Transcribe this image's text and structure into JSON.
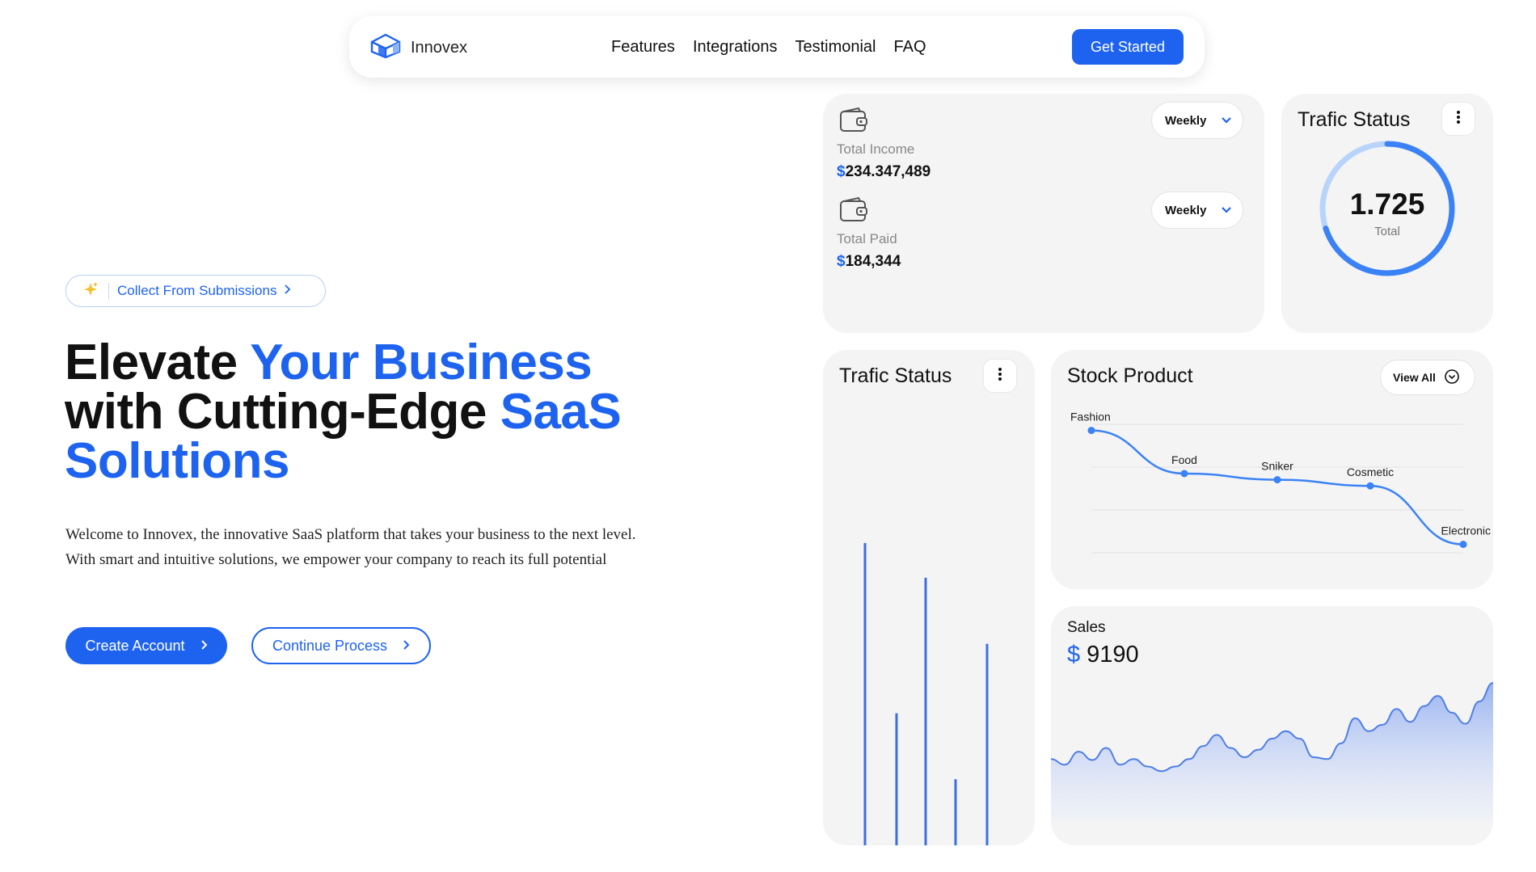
{
  "nav": {
    "brand": "Innovex",
    "links": [
      "Features",
      "Integrations",
      "Testimonial",
      "FAQ"
    ],
    "cta": "Get Started"
  },
  "hero": {
    "pill": "Collect From Submissions",
    "title_parts": [
      "Elevate ",
      "Your Business",
      " with Cutting-Edge ",
      "SaaS Solutions"
    ],
    "description": "Welcome to Innovex, the innovative SaaS platform that takes your business to the next level. With smart and intuitive solutions, we empower your company to reach its full potential",
    "create_btn": "Create Account",
    "continue_btn": "Continue Process"
  },
  "income_card": {
    "income_label": "Total Income",
    "income_currency": "$",
    "income_value": "234.347,489",
    "income_period": "Weekly",
    "paid_label": "Total Paid",
    "paid_currency": "$",
    "paid_value": "184,344",
    "paid_period": "Weekly"
  },
  "traffic_ring": {
    "title": "Trafic Status",
    "value": "1.725",
    "caption": "Total",
    "progress": 0.7,
    "colors": {
      "primary": "#3b82f6",
      "light": "#b8d4fb"
    }
  },
  "traffic_bars": {
    "title": "Trafic Status",
    "chart_data": {
      "type": "bar",
      "values": [
        0.87,
        0.38,
        0.77,
        0.19,
        0.58
      ],
      "color": "#3b6fe0"
    }
  },
  "stock_card": {
    "title": "Stock Product",
    "view_all": "View All",
    "chart_data": {
      "type": "line",
      "categories": [
        "Fashion",
        "Food",
        "Sniker",
        "Cosmetic",
        "Electronic"
      ],
      "values": [
        4.0,
        2.6,
        2.4,
        2.2,
        0.3
      ],
      "ylim": [
        0,
        4.2
      ],
      "color": "#3b82f6"
    }
  },
  "sales_card": {
    "label": "Sales",
    "currency": "$",
    "value": "9190",
    "chart_data": {
      "type": "area",
      "values": [
        0.18,
        0.12,
        0.26,
        0.17,
        0.3,
        0.12,
        0.18,
        0.1,
        0.05,
        0.1,
        0.18,
        0.32,
        0.44,
        0.3,
        0.2,
        0.28,
        0.4,
        0.48,
        0.4,
        0.2,
        0.18,
        0.35,
        0.62,
        0.48,
        0.55,
        0.72,
        0.58,
        0.75,
        0.86,
        0.68,
        0.56,
        0.8,
        1.0
      ],
      "color": "#4f7fe6"
    }
  }
}
